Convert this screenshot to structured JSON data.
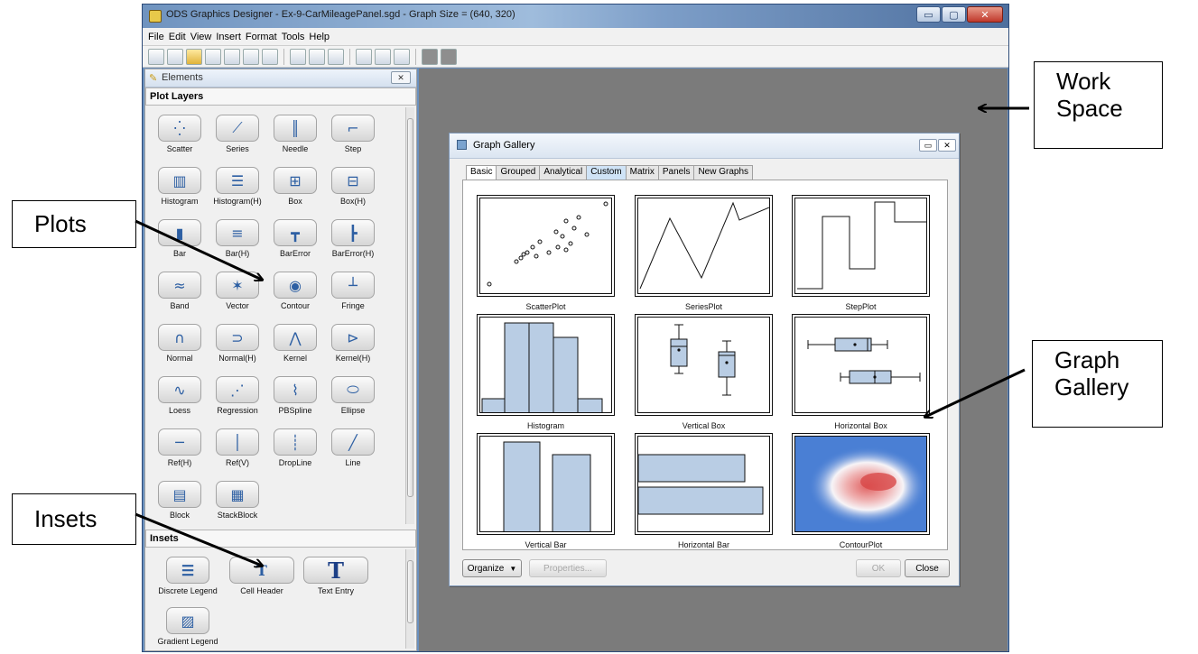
{
  "window": {
    "title": "ODS Graphics Designer - Ex-9-CarMileagePanel.sgd - Graph Size = (640, 320)",
    "controls": [
      "▭",
      "▢",
      "✕"
    ]
  },
  "menu": [
    "File",
    "Edit",
    "View",
    "Insert",
    "Format",
    "Tools",
    "Help"
  ],
  "toolbar_icons": [
    "new-graph-icon",
    "new-from-gallery-icon",
    "open-icon",
    "save-icon",
    "save-as-icon",
    "print-icon",
    "print-preview-icon",
    "undo-icon",
    "redo-icon",
    "copy-icon",
    "zoom-icon",
    "properties-icon",
    "data-icon",
    "layout-a-icon",
    "layout-b-icon"
  ],
  "elements_panel": {
    "title": "Elements",
    "plot_layers_title": "Plot Layers",
    "plot_layers": [
      "Scatter",
      "Series",
      "Needle",
      "Step",
      "Histogram",
      "Histogram(H)",
      "Box",
      "Box(H)",
      "Bar",
      "Bar(H)",
      "BarError",
      "BarError(H)",
      "Band",
      "Vector",
      "Contour",
      "Fringe",
      "Normal",
      "Normal(H)",
      "Kernel",
      "Kernel(H)",
      "Loess",
      "Regression",
      "PBSpline",
      "Ellipse",
      "Ref(H)",
      "Ref(V)",
      "DropLine",
      "Line",
      "Block",
      "StackBlock"
    ],
    "insets_title": "Insets",
    "insets": [
      "Discrete Legend",
      "Cell Header",
      "Text Entry",
      "Gradient Legend"
    ]
  },
  "gallery": {
    "title": "Graph Gallery",
    "tabs": [
      "Basic",
      "Grouped",
      "Analytical",
      "Custom",
      "Matrix",
      "Panels",
      "New Graphs"
    ],
    "active_tab": "Basic",
    "items": [
      "ScatterPlot",
      "SeriesPlot",
      "StepPlot",
      "Histogram",
      "Vertical Box",
      "Horizontal Box",
      "Vertical Bar",
      "Horizontal Bar",
      "ContourPlot"
    ],
    "organize_label": "Organize",
    "properties_label": "Properties...",
    "ok_label": "OK",
    "close_label": "Close"
  },
  "callouts": {
    "work_space": "Work Space",
    "plots": "Plots",
    "graph_gallery": "Graph Gallery",
    "insets": "Insets"
  },
  "colors": {
    "bar_fill": "#b9cde4",
    "workspace": "#7b7b7b",
    "title_bar": "#8eaed4"
  }
}
